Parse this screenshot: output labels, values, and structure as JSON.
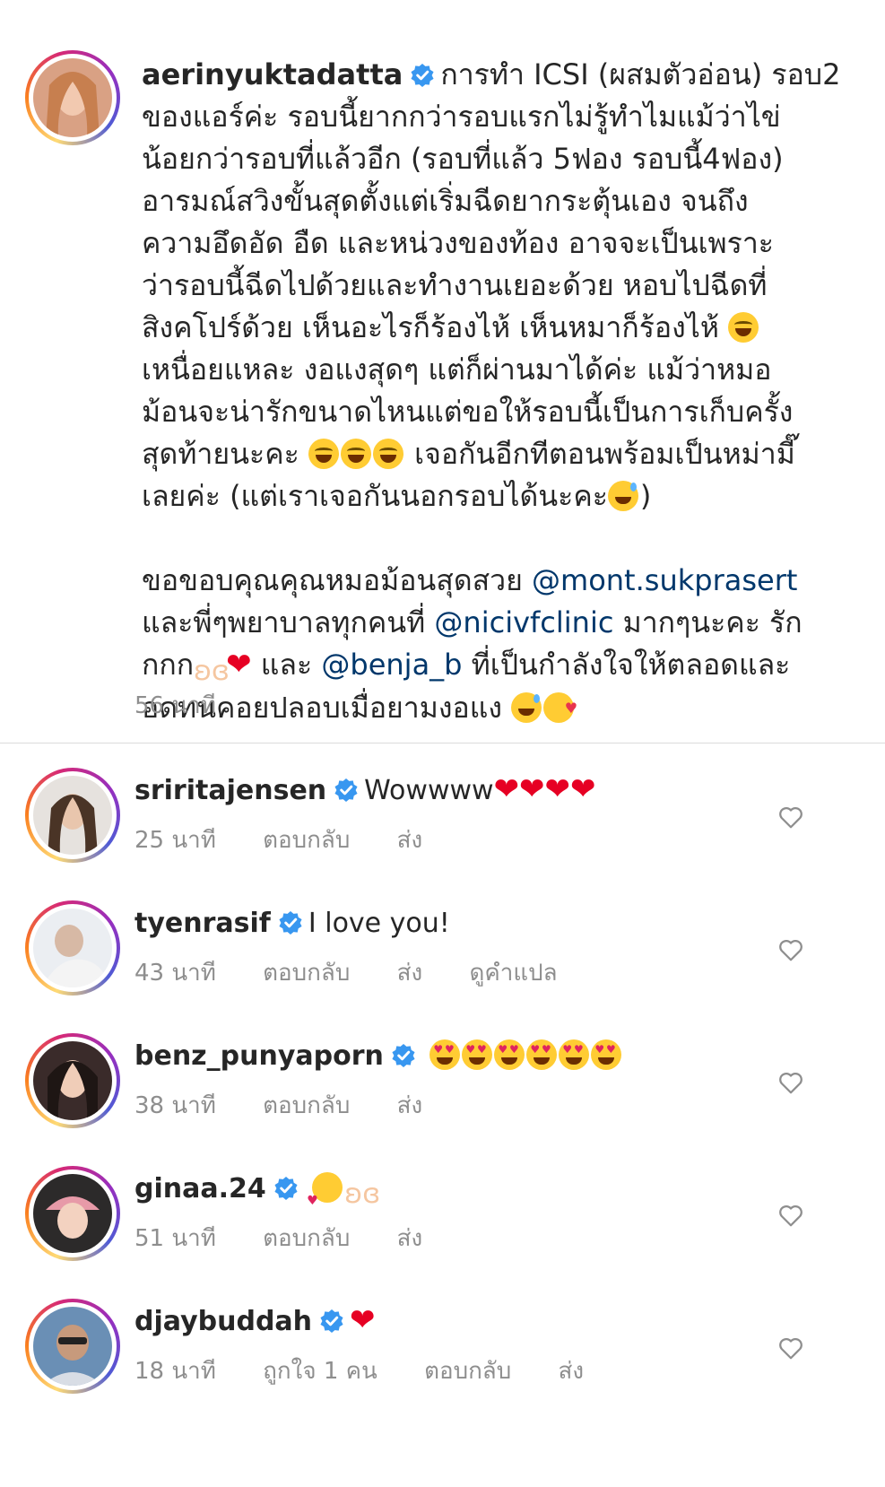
{
  "caption": {
    "username": "aerinyuktadatta",
    "lines": [
      "การทำ ICSI (ผสมตัวอ่อน) รอบ2",
      "ของแอร์ค่ะ รอบนี้ยากกว่ารอบแรกไม่รู้ทำไมแม้ว่าไข่",
      "น้อยกว่ารอบที่แล้วอีก (รอบที่แล้ว 5ฟอง รอบนี้4ฟอง)",
      "อารมณ์สวิงขั้นสุดตั้งแต่เริ่มฉีดยากระตุ้นเอง จนถึง",
      "ความอึดอัด อืด และหน่วงของท้อง อาจจะเป็นเพราะ",
      "ว่ารอบนี้ฉีดไปด้วยและทำงานเยอะด้วย หอบไปฉีดที่",
      "สิงคโปร์ด้วย เห็นอะไรก็ร้องไห้ เห็นหมาก็ร้องไห้",
      "เหนื่อยแหละ งอแงสุดๆ แต่ก็ผ่านมาได้ค่ะ แม้ว่าหมอ",
      "ม้อนจะน่ารักขนาดไหนแต่ขอให้รอบนี้เป็นการเก็บครั้ง",
      "สุดท้ายนะคะ",
      "เจอกันอีกทีตอนพร้อมเป็นหม่ามี๊",
      "เลยค่ะ (แต่เราเจอกันนอกรอบได้นะคะ",
      ")"
    ],
    "para2_a": "ขอขอบคุณคุณหมอม้อนสุดสวย",
    "mention1": "@mont.sukprasert",
    "para2_b": "และพี่ๆพยาบาลทุกคนที่",
    "mention2": "@nicivfclinic",
    "para2_c": "มากๆนะคะ รัก",
    "para2_d": "กกก",
    "para2_e": "และ",
    "mention3": "@benja_b",
    "para2_f": "ที่เป็นกำลังใจให้ตลอดและ",
    "para2_g": "อดทนคอยปลอบเมื่อยามงอแง",
    "time": "56 นาที"
  },
  "comments": [
    {
      "username": "sriritajensen",
      "text": "Wowwww",
      "time": "25 นาที",
      "reply": "ตอบกลับ",
      "send": "ส่ง"
    },
    {
      "username": "tyenrasif",
      "text": "I love you!",
      "time": "43 นาที",
      "reply": "ตอบกลับ",
      "send": "ส่ง",
      "translate": "ดูคำแปล"
    },
    {
      "username": "benz_punyaporn",
      "text": "",
      "time": "38 นาที",
      "reply": "ตอบกลับ",
      "send": "ส่ง"
    },
    {
      "username": "ginaa.24",
      "text": "",
      "time": "51 นาที",
      "reply": "ตอบกลับ",
      "send": "ส่ง"
    },
    {
      "username": "djaybuddah",
      "text": "",
      "time": "18 นาที",
      "likes": "ถูกใจ 1 คน",
      "reply": "ตอบกลับ",
      "send": "ส่ง"
    }
  ],
  "colors": {
    "link": "#00376b",
    "verified": "#3897f0",
    "meta": "#8e8e8e",
    "heart": "#e60023"
  }
}
